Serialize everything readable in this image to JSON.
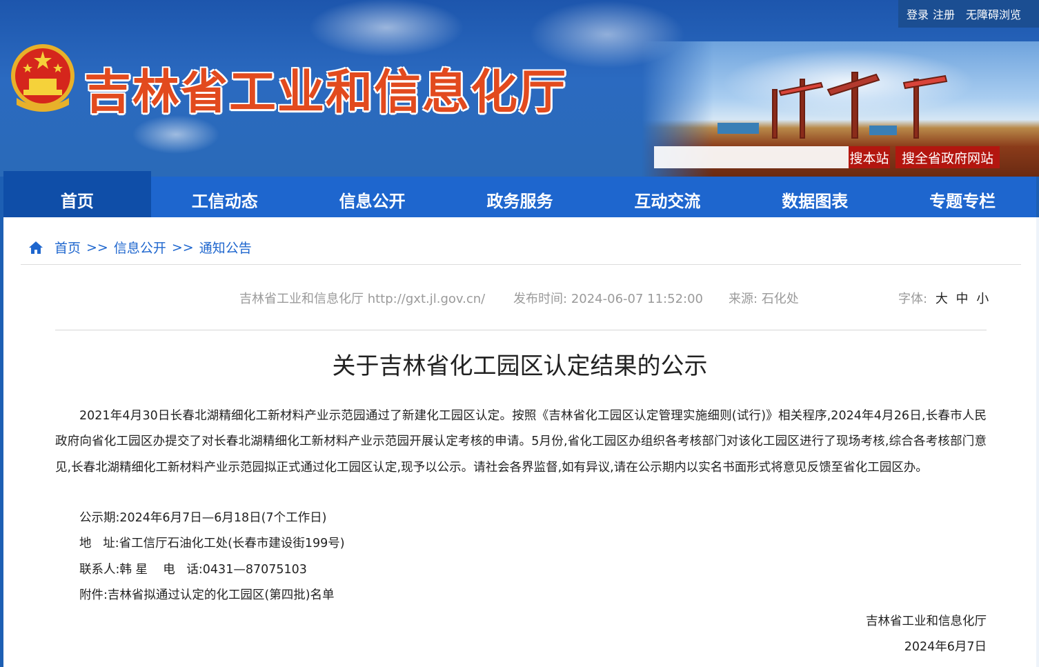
{
  "header": {
    "site_title": "吉林省工业和信息化厅",
    "login": "登录",
    "register": "注册",
    "accessibility": "无障碍浏览",
    "search_placeholder": "",
    "search_site": "搜本站",
    "search_all": "搜全省政府网站"
  },
  "nav": {
    "items": [
      {
        "label": "首页"
      },
      {
        "label": "工信动态"
      },
      {
        "label": "信息公开"
      },
      {
        "label": "政务服务"
      },
      {
        "label": "互动交流"
      },
      {
        "label": "数据图表"
      },
      {
        "label": "专题专栏"
      }
    ],
    "active_index": 0
  },
  "breadcrumb": {
    "items": [
      "首页",
      "信息公开",
      "通知公告"
    ],
    "separator": ">>"
  },
  "meta": {
    "source_site": "吉林省工业和信息化厅 http://gxt.jl.gov.cn/",
    "publish_label": "发布时间:",
    "publish_time": "2024-06-07 11:52:00",
    "origin_label": "来源:",
    "origin": "石化处",
    "font_label": "字体:",
    "font_large": "大",
    "font_medium": "中",
    "font_small": "小"
  },
  "article": {
    "title": "关于吉林省化工园区认定结果的公示",
    "paragraph": "2021年4月30日长春北湖精细化工新材料产业示范园通过了新建化工园区认定。按照《吉林省化工园区认定管理实施细则(试行)》相关程序,2024年4月26日,长春市人民政府向省化工园区办提交了对长春北湖精细化工新材料产业示范园开展认定考核的申请。5月份,省化工园区办组织各考核部门对该化工园区进行了现场考核,综合各考核部门意见,长春北湖精细化工新材料产业示范园拟正式通过化工园区认定,现予以公示。请社会各界监督,如有异议,请在公示期内以实名书面形式将意见反馈至省化工园区办。",
    "period": "公示期:2024年6月7日—6月18日(7个工作日)",
    "address": "地   址:省工信厅石油化工处(长春市建设街199号)",
    "contact": "联系人:韩 星    电   话:0431—87075103",
    "attachment": "附件:吉林省拟通过认定的化工园区(第四批)名单",
    "signature_org": "吉林省工业和信息化厅",
    "signature_date": "2024年6月7日"
  }
}
